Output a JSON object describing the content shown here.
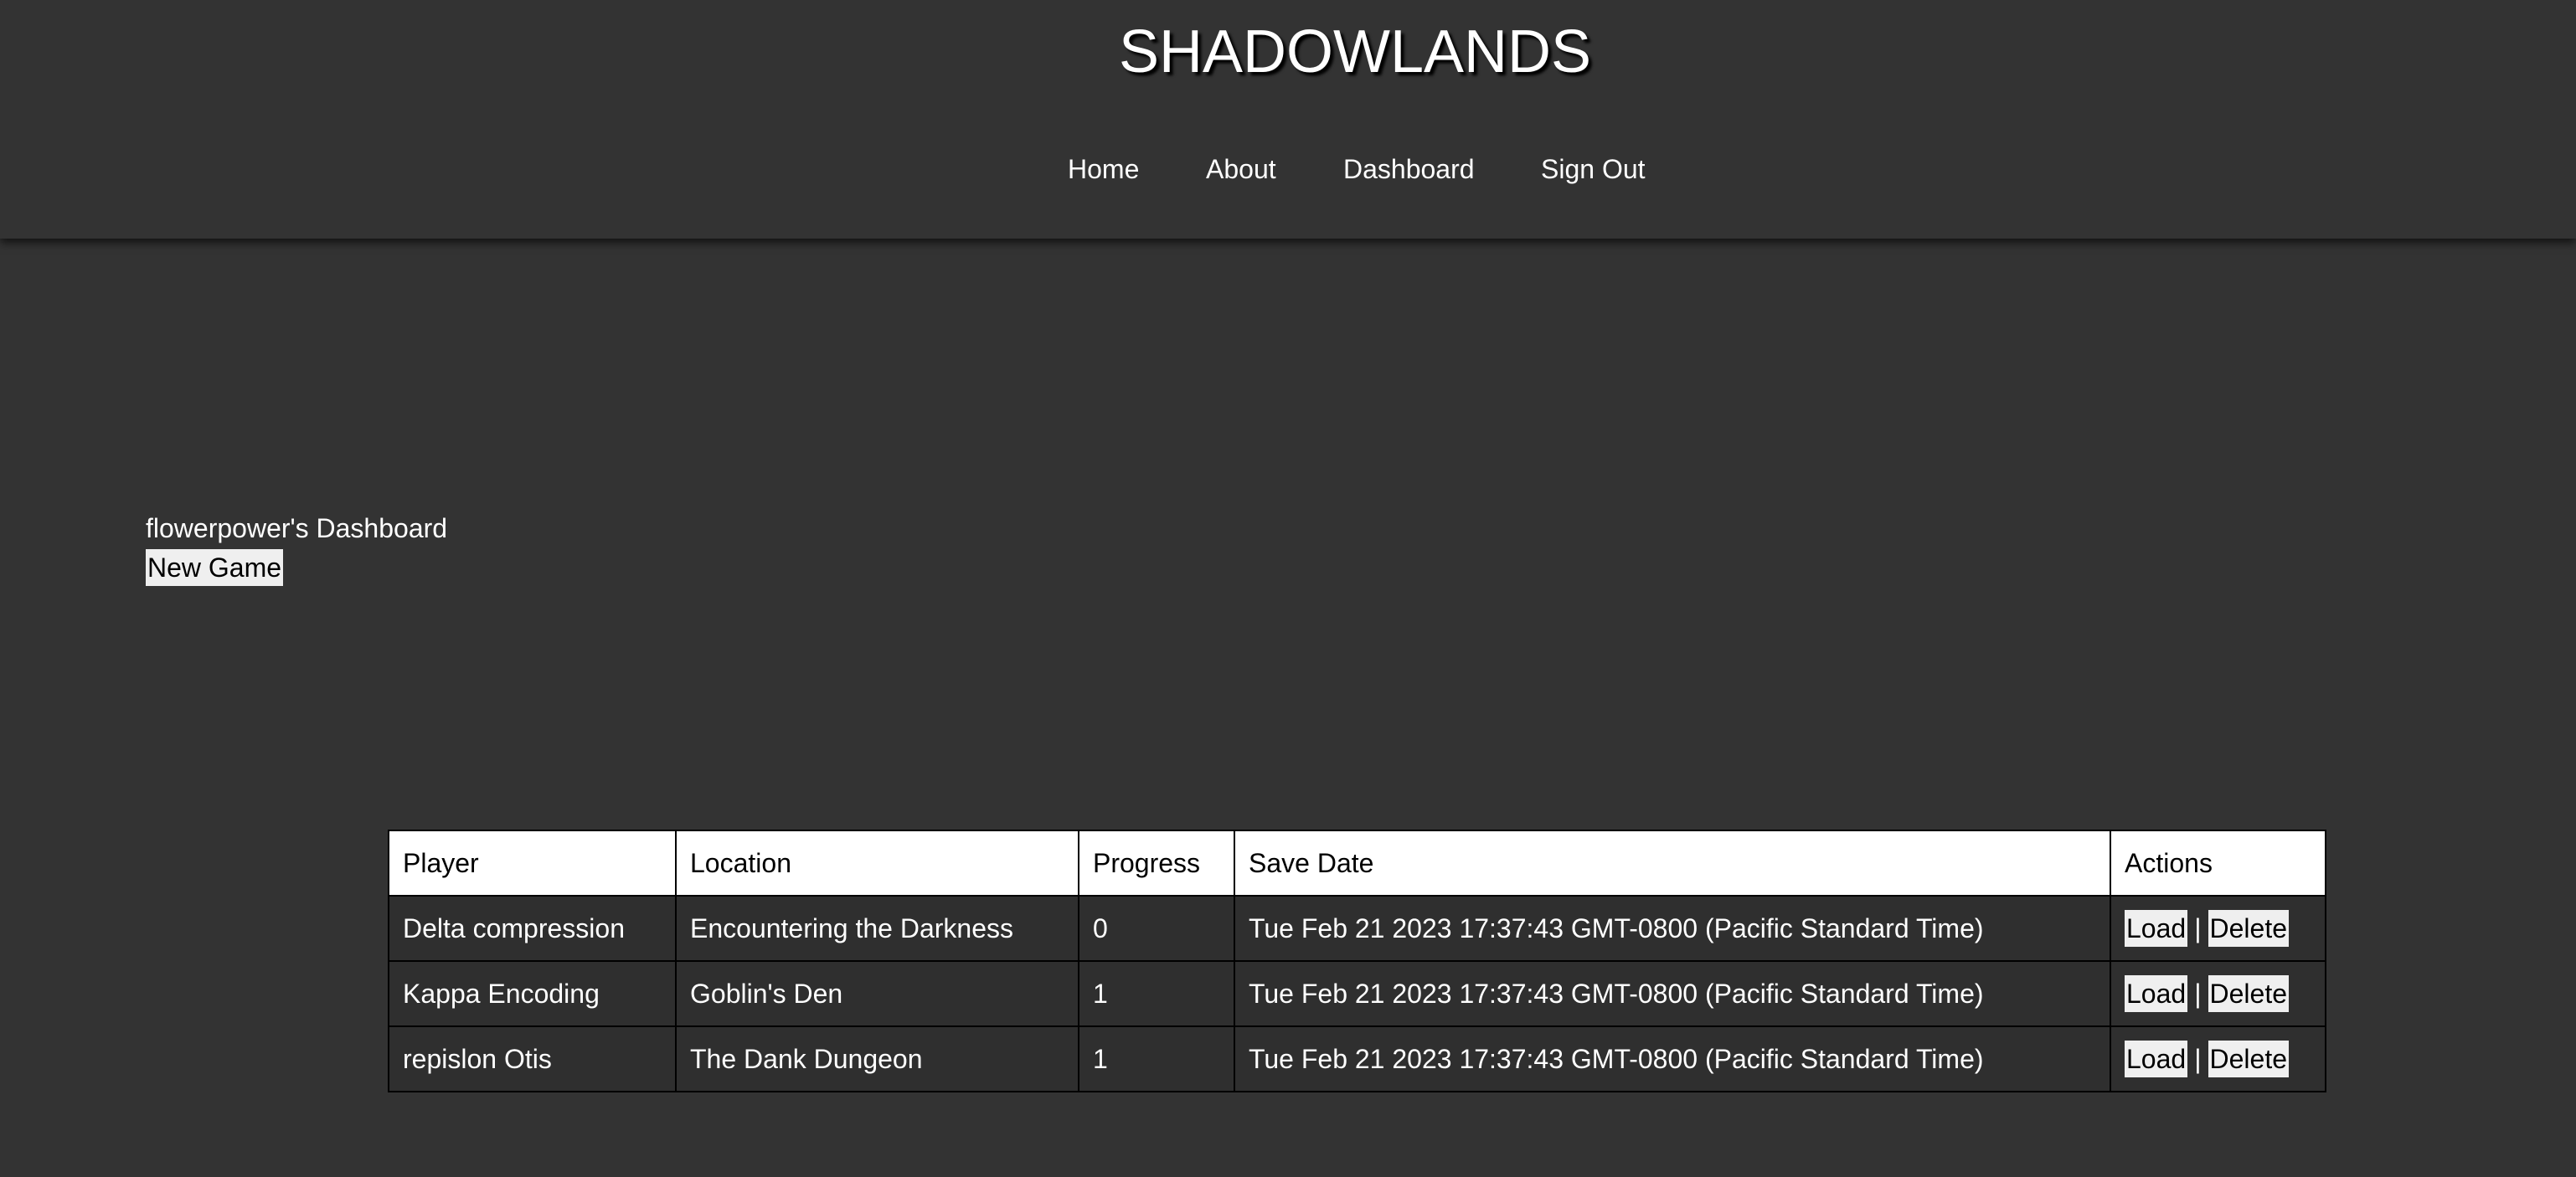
{
  "site": {
    "title": "SHADOWLANDS"
  },
  "nav": {
    "home": "Home",
    "about": "About",
    "dashboard": "Dashboard",
    "sign_out": "Sign Out"
  },
  "dashboard": {
    "title": "flowerpower's Dashboard",
    "new_game_label": "New Game"
  },
  "table": {
    "headers": [
      "Player",
      "Location",
      "Progress",
      "Save Date",
      "Actions"
    ],
    "rows": [
      {
        "player": "Delta compression",
        "location": "Encountering the Darkness",
        "progress": "0",
        "save_date": "Tue Feb 21 2023 17:37:43 GMT-0800 (Pacific Standard Time)",
        "load_label": "Load",
        "separator": "|",
        "delete_label": "Delete"
      },
      {
        "player": "Kappa Encoding",
        "location": "Goblin's Den",
        "progress": "1",
        "save_date": "Tue Feb 21 2023 17:37:43 GMT-0800 (Pacific Standard Time)",
        "load_label": "Load",
        "separator": "|",
        "delete_label": "Delete"
      },
      {
        "player": "repislon Otis",
        "location": "The Dank Dungeon",
        "progress": "1",
        "save_date": "Tue Feb 21 2023 17:37:43 GMT-0800 (Pacific Standard Time)",
        "load_label": "Load",
        "separator": "|",
        "delete_label": "Delete"
      }
    ]
  },
  "colors": {
    "background": "#333333",
    "text": "#ffffff",
    "header_cell_background": "#ffffff",
    "button_background": "#efefef"
  }
}
